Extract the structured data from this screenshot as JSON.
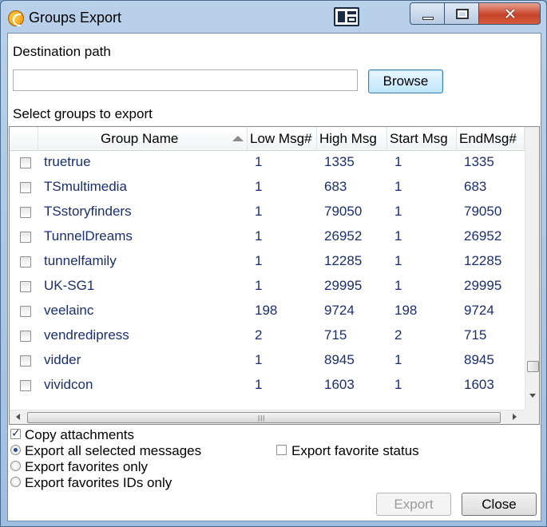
{
  "window": {
    "title": "Groups Export",
    "controls": {
      "minimize": "minimize-icon",
      "maximize": "maximize-icon",
      "close": "close-icon"
    }
  },
  "destination": {
    "label": "Destination path",
    "value": "",
    "browse_label": "Browse"
  },
  "groups": {
    "label": "Select groups to export",
    "columns": [
      "Group Name",
      "Low Msg#",
      "High Msg",
      "Start Msg",
      "EndMsg#"
    ],
    "rows": [
      {
        "name": "truetrue",
        "low": "1",
        "high": "1335",
        "start": "1",
        "end": "1335",
        "checked": false
      },
      {
        "name": "TSmultimedia",
        "low": "1",
        "high": "683",
        "start": "1",
        "end": "683",
        "checked": false
      },
      {
        "name": "TSstoryfinders",
        "low": "1",
        "high": "79050",
        "start": "1",
        "end": "79050",
        "checked": false
      },
      {
        "name": "TunnelDreams",
        "low": "1",
        "high": "26952",
        "start": "1",
        "end": "26952",
        "checked": false
      },
      {
        "name": "tunnelfamily",
        "low": "1",
        "high": "12285",
        "start": "1",
        "end": "12285",
        "checked": false
      },
      {
        "name": "UK-SG1",
        "low": "1",
        "high": "29995",
        "start": "1",
        "end": "29995",
        "checked": false
      },
      {
        "name": "veelainc",
        "low": "198",
        "high": "9724",
        "start": "198",
        "end": "9724",
        "checked": false
      },
      {
        "name": "vendredipress",
        "low": "2",
        "high": "715",
        "start": "2",
        "end": "715",
        "checked": false
      },
      {
        "name": "vidder",
        "low": "1",
        "high": "8945",
        "start": "1",
        "end": "8945",
        "checked": false
      },
      {
        "name": "vividcon",
        "low": "1",
        "high": "1603",
        "start": "1",
        "end": "1603",
        "checked": false
      }
    ]
  },
  "options": {
    "copy_attachments": {
      "label": "Copy attachments",
      "checked": true
    },
    "export_favorite_status": {
      "label": "Export favorite status",
      "checked": false
    },
    "radios": [
      {
        "label": "Export all selected messages",
        "selected": true
      },
      {
        "label": "Export favorites only",
        "selected": false
      },
      {
        "label": "Export favorites IDs only",
        "selected": false
      }
    ]
  },
  "buttons": {
    "export_label": "Export",
    "close_label": "Close"
  }
}
